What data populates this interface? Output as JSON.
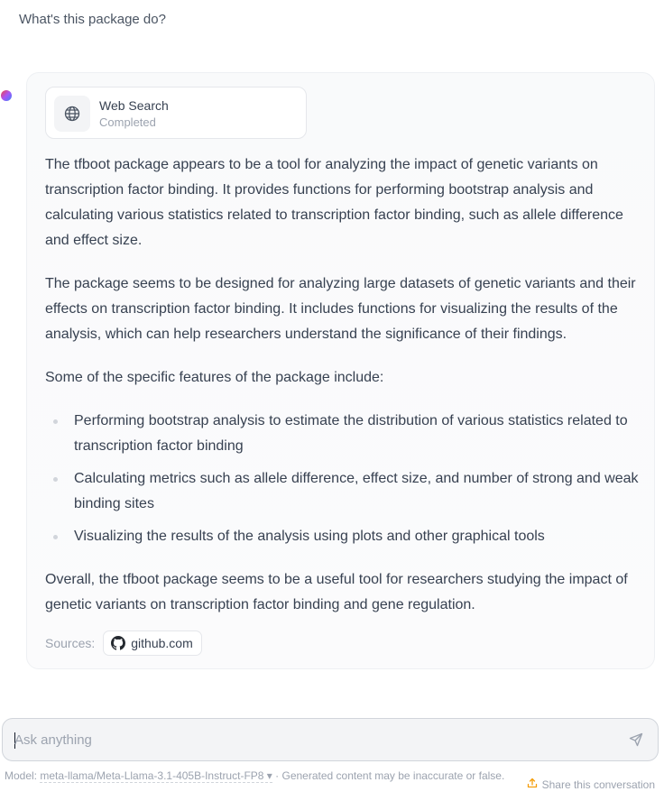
{
  "user_message": "What's this package do?",
  "tool_call": {
    "title": "Web Search",
    "status": "Completed",
    "icon": "globe-icon"
  },
  "answer": {
    "paragraphs": [
      "The tfboot package appears to be a tool for analyzing the impact of genetic variants on transcription factor binding. It provides functions for performing bootstrap analysis and calculating various statistics related to transcription factor binding, such as allele difference and effect size.",
      "The package seems to be designed for analyzing large datasets of genetic variants and their effects on transcription factor binding. It includes functions for visualizing the results of the analysis, which can help researchers understand the significance of their findings.",
      "Some of the specific features of the package include:"
    ],
    "bullets": [
      "Performing bootstrap analysis to estimate the distribution of various statistics related to transcription factor binding",
      "Calculating metrics such as allele difference, effect size, and number of strong and weak binding sites",
      "Visualizing the results of the analysis using plots and other graphical tools"
    ],
    "conclusion": "Overall, the tfboot package seems to be a useful tool for researchers studying the impact of genetic variants on transcription factor binding and gene regulation."
  },
  "sources": {
    "label": "Sources:",
    "items": [
      {
        "label": "github.com",
        "icon": "github-icon"
      }
    ]
  },
  "composer": {
    "placeholder": "Ask anything",
    "send_icon": "send-icon"
  },
  "footer": {
    "model_prefix": "Model: ",
    "model_name": "meta-llama/Meta-Llama-3.1-405B-Instruct-FP8",
    "model_caret": "▾",
    "disclaimer": " · Generated content may be inaccurate or false.",
    "share_label": "Share this conversation"
  },
  "colors": {
    "accent_share_icon": "#f59e0b",
    "text": "#374151",
    "muted": "#9ca3af"
  }
}
